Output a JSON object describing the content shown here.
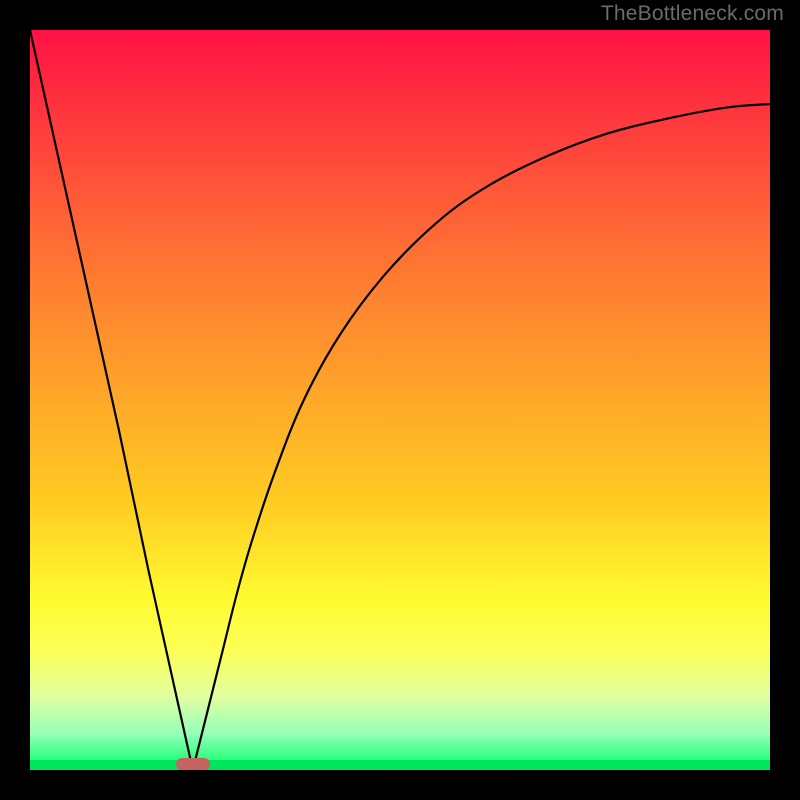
{
  "watermark": "TheBottleneck.com",
  "chart_data": {
    "type": "line",
    "title": "",
    "xlabel": "",
    "ylabel": "",
    "xlim": [
      0,
      100
    ],
    "ylim": [
      0,
      100
    ],
    "grid": false,
    "legend": false,
    "series": [
      {
        "name": "bottleneck-curve-left",
        "x": [
          0,
          4,
          8,
          12,
          16,
          20,
          22
        ],
        "values": [
          100,
          82,
          64,
          46,
          27,
          9,
          0
        ]
      },
      {
        "name": "bottleneck-curve-right",
        "x": [
          22,
          24,
          26,
          28,
          30,
          33,
          37,
          42,
          48,
          55,
          62,
          70,
          78,
          86,
          94,
          100
        ],
        "values": [
          0,
          8,
          16,
          24,
          31,
          40,
          50,
          59,
          67,
          74,
          79,
          83,
          86,
          88,
          89.5,
          90
        ]
      }
    ],
    "marker": {
      "name": "optimal-point",
      "x": 22,
      "y": 0,
      "color": "#c76262"
    },
    "gradient_stops": [
      {
        "pos": 0.0,
        "color": "#ff1244"
      },
      {
        "pos": 0.5,
        "color": "#ffa828"
      },
      {
        "pos": 0.8,
        "color": "#fffb30"
      },
      {
        "pos": 1.0,
        "color": "#00ff66"
      }
    ]
  },
  "layout": {
    "image_size": 800,
    "frame_border": 30,
    "plot_size": 740
  }
}
